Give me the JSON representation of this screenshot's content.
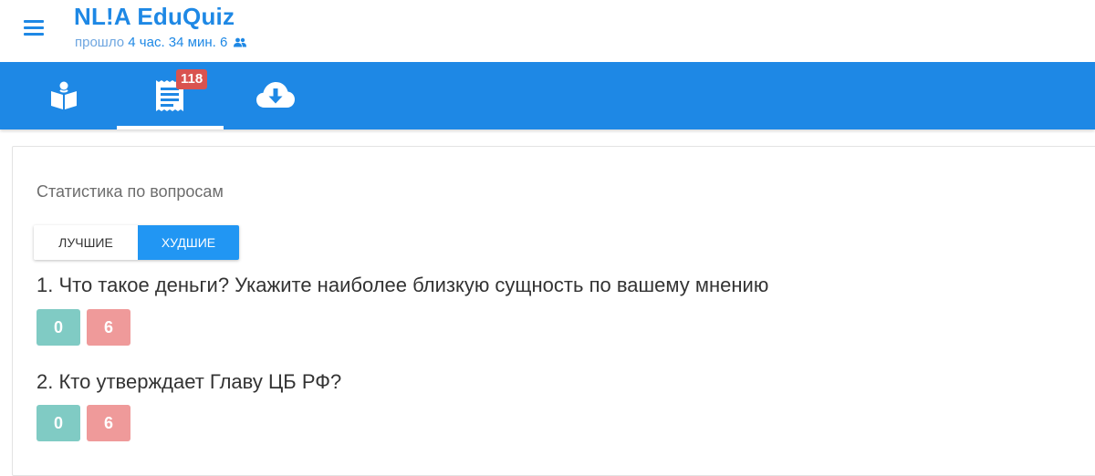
{
  "app": {
    "title": "NL!A EduQuiz",
    "elapsed_prefix": "прошло",
    "elapsed_value": "4 час. 34 мин.",
    "participants": "6"
  },
  "tabs": [
    {
      "name": "reading",
      "icon": "book-reader-icon",
      "active": false
    },
    {
      "name": "questions",
      "icon": "list-document-icon",
      "active": true,
      "badge": "118"
    },
    {
      "name": "download",
      "icon": "cloud-download-icon",
      "active": false
    }
  ],
  "stats": {
    "title": "Статистика по вопросам",
    "toggle": {
      "best_label": "ЛУЧШИЕ",
      "worst_label": "ХУДШИЕ",
      "selected": "worst"
    },
    "questions": [
      {
        "text": "1. Что такое деньги? Укажите наиболее близкую сущность по вашему мнению",
        "correct": "0",
        "wrong": "6"
      },
      {
        "text": "2. Кто утверждает Главу ЦБ РФ?",
        "correct": "0",
        "wrong": "6"
      }
    ]
  },
  "colors": {
    "primary": "#1e88e5",
    "badge": "#d9534f",
    "correct_chip": "#80cbc4",
    "wrong_chip": "#ef9a9a"
  }
}
